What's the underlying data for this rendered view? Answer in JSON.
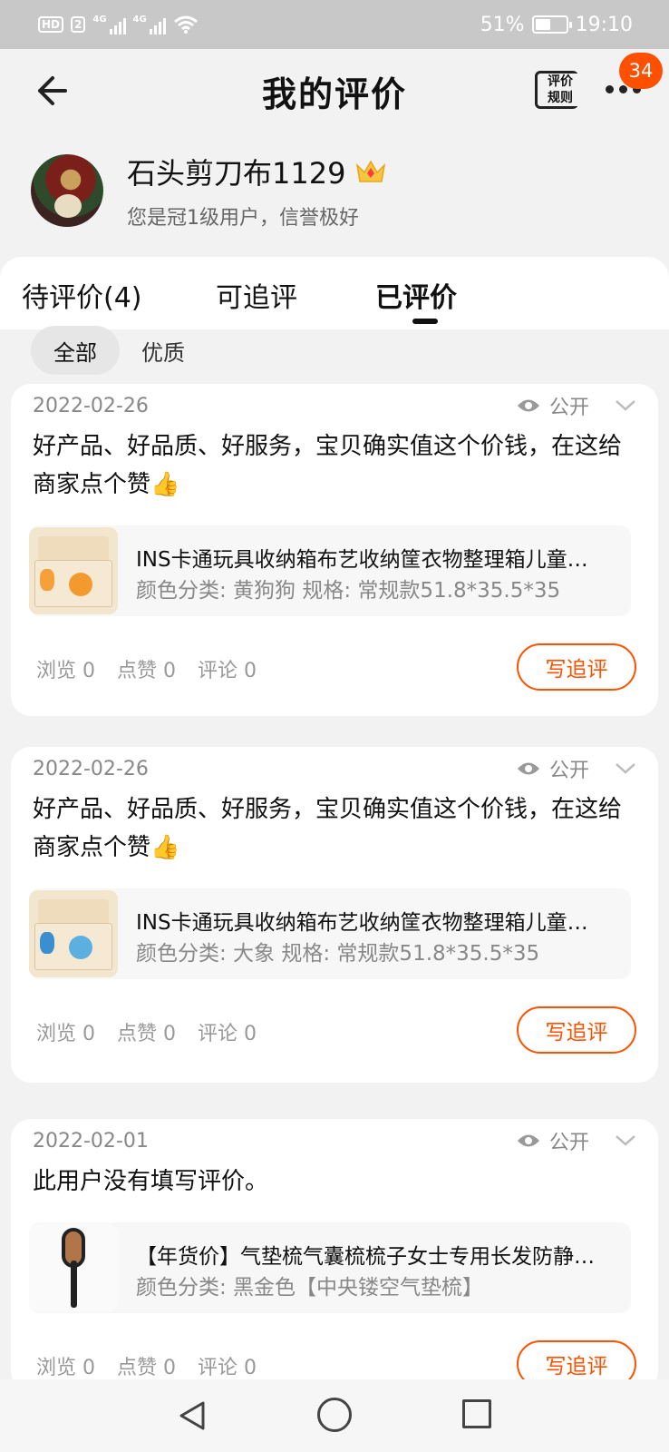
{
  "status_bar": {
    "hd": "HD",
    "sim": "2",
    "net1": "4G",
    "net2": "4G",
    "battery": "51%",
    "time": "19:10"
  },
  "header": {
    "title": "我的评价",
    "rules_label": "评价规则",
    "rules_line1": "评价",
    "rules_line2": "规则",
    "badge": "34"
  },
  "profile": {
    "username": "石头剪刀布1129",
    "credit": "您是冠1级用户，信誉极好"
  },
  "tabs": [
    {
      "label": "待评价(4)"
    },
    {
      "label": "可追评"
    },
    {
      "label": "已评价",
      "active": true
    }
  ],
  "filters": [
    {
      "label": "全部",
      "active": true
    },
    {
      "label": "优质"
    }
  ],
  "reviews": [
    {
      "date": "2022-02-26",
      "visibility": "公开",
      "text": "好产品、好品质、好服务，宝贝确实值这个价钱，在这给商家点个赞👍",
      "product_title": "INS卡通玩具收纳箱布艺收纳筐衣物整理箱儿童储物箱",
      "product_spec": "颜色分类: 黄狗狗 规格: 常规款51.8*35.5*35",
      "views": "浏览 0",
      "likes": "点赞 0",
      "comments": "评论 0",
      "action": "写追评"
    },
    {
      "date": "2022-02-26",
      "visibility": "公开",
      "text": "好产品、好品质、好服务，宝贝确实值这个价钱，在这给商家点个赞👍",
      "product_title": "INS卡通玩具收纳箱布艺收纳筐衣物整理箱儿童储物箱",
      "product_spec": "颜色分类: 大象 规格: 常规款51.8*35.5*35",
      "views": "浏览 0",
      "likes": "点赞 0",
      "comments": "评论 0",
      "action": "写追评"
    },
    {
      "date": "2022-02-01",
      "visibility": "公开",
      "text": "此用户没有填写评价。",
      "product_title": "【年货价】气垫梳气囊梳梳子女士专用长发防静电按摩梳",
      "product_spec": "颜色分类: 黑金色【中央镂空气垫梳】",
      "views": "浏览 0",
      "likes": "点赞 0",
      "comments": "评论 0",
      "action": "写追评"
    }
  ],
  "colors": {
    "accent": "#ff5000",
    "background": "#f2f2f2",
    "status_bar": "#c8c8c8"
  },
  "icons": {
    "back": "arrow-left-icon",
    "crown": "crown-icon",
    "eye": "eye-icon",
    "chevron": "chevron-down-icon",
    "more": "more-dots-icon"
  }
}
